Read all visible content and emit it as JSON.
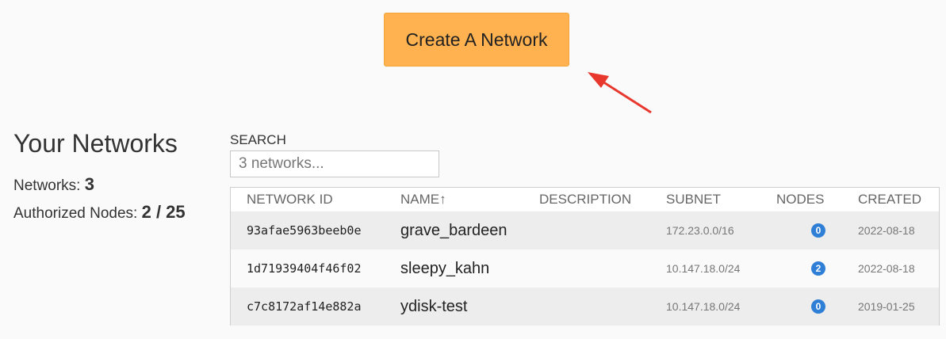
{
  "create_button": {
    "label": "Create A Network"
  },
  "sidebar": {
    "title": "Your Networks",
    "networks_label": "Networks:",
    "networks_count": "3",
    "nodes_label": "Authorized Nodes:",
    "nodes_count": "2 / 25"
  },
  "search": {
    "label": "SEARCH",
    "placeholder": "3 networks..."
  },
  "table": {
    "headers": {
      "network_id": "NETWORK ID",
      "name": "NAME↑",
      "description": "DESCRIPTION",
      "subnet": "SUBNET",
      "nodes": "NODES",
      "created": "CREATED"
    },
    "rows": [
      {
        "network_id": "93afae5963beeb0e",
        "name": "grave_bardeen",
        "description": "",
        "subnet": "172.23.0.0/16",
        "nodes": "0",
        "created": "2022-08-18"
      },
      {
        "network_id": "1d71939404f46f02",
        "name": "sleepy_kahn",
        "description": "",
        "subnet": "10.147.18.0/24",
        "nodes": "2",
        "created": "2022-08-18"
      },
      {
        "network_id": "c7c8172af14e882a",
        "name": "ydisk-test",
        "description": "",
        "subnet": "10.147.18.0/24",
        "nodes": "0",
        "created": "2019-01-25"
      }
    ]
  },
  "colors": {
    "button": "#ffb24f",
    "arrow": "#e8382e",
    "badge": "#2f7fd6"
  }
}
